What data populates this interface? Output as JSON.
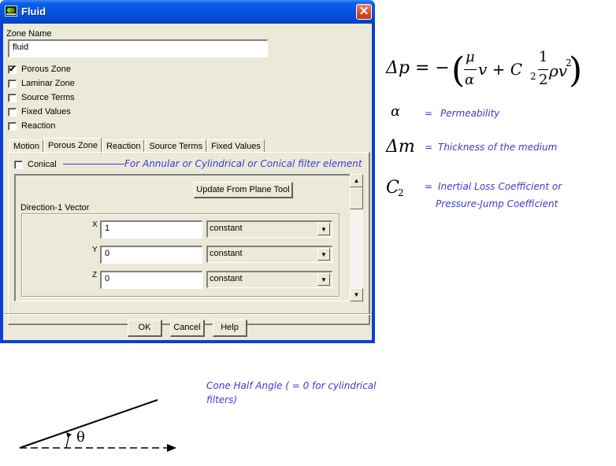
{
  "window": {
    "title": "Fluid",
    "icon": "fluent-app-icon",
    "close_glyph": "✕"
  },
  "zone_name": {
    "label": "Zone Name",
    "value": "fluid"
  },
  "options": [
    {
      "label": "Porous Zone",
      "checked": true
    },
    {
      "label": "Laminar Zone",
      "checked": false
    },
    {
      "label": "Source Terms",
      "checked": false
    },
    {
      "label": "Fixed Values",
      "checked": false
    },
    {
      "label": "Reaction",
      "checked": false
    }
  ],
  "tabs": [
    {
      "label": "Motion",
      "active": false
    },
    {
      "label": "Porous Zone",
      "active": true
    },
    {
      "label": "Reaction",
      "active": false
    },
    {
      "label": "Source Terms",
      "active": false
    },
    {
      "label": "Fixed Values",
      "active": false
    }
  ],
  "porous_panel": {
    "conical_label": "Conical",
    "conical_checked": false,
    "update_button": "Update From Plane Tool",
    "direction_group_label": "Direction-1 Vector",
    "components": [
      {
        "axis": "X",
        "value": "1",
        "method": "constant"
      },
      {
        "axis": "Y",
        "value": "0",
        "method": "constant"
      },
      {
        "axis": "Z",
        "value": "0",
        "method": "constant"
      }
    ],
    "scroll_up_glyph": "▲",
    "scroll_down_glyph": "▼",
    "dropdown_glyph": "▼"
  },
  "buttons": {
    "ok": "OK",
    "cancel": "Cancel",
    "help": "Help"
  },
  "annotations": {
    "conical_note": "For Annular or Cylindrical or Conical filter element",
    "cone_angle_line1": "Cone Half Angle ( = 0 for cylindrical",
    "cone_angle_line2": "filters)",
    "theta": "θ",
    "annotation_color": "#3b3bd0"
  },
  "equation": {
    "lhs": "Δp = −",
    "mu": "μ",
    "alpha": "α",
    "v": "v + C",
    "c_sub": "2",
    "one": "1",
    "two": "2",
    "rho_v": "ρv",
    "sq": "2",
    "definitions": [
      {
        "symbol": "α",
        "sub": "",
        "eq": "=",
        "meaning": "Permeability"
      },
      {
        "symbol": "Δm",
        "sub": "",
        "eq": "=",
        "meaning": "Thickness of the medium"
      },
      {
        "symbol": "C",
        "sub": "2",
        "eq": "=",
        "meaning": "Inertial Loss Coefficient or",
        "meaning2": "Pressure-Jump Coefficient"
      }
    ]
  }
}
